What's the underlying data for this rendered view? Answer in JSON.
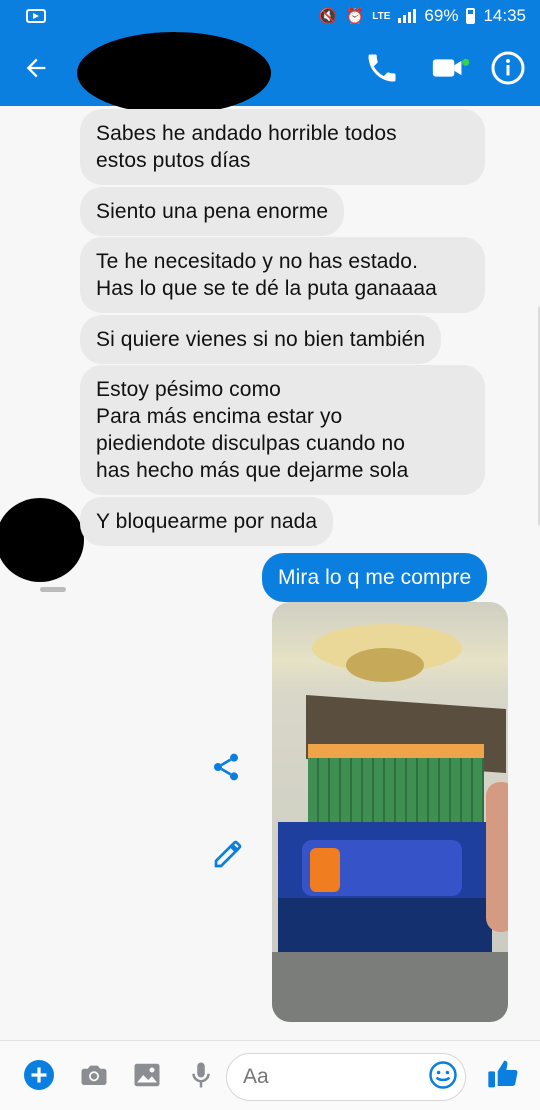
{
  "status_bar": {
    "network": "LTE",
    "battery": "69%",
    "time": "14:35"
  },
  "header": {
    "icons": [
      "back-arrow-icon",
      "phone-icon",
      "video-camera-icon",
      "info-icon"
    ],
    "accent_color": "#0a7fe0",
    "active_dot_color": "#3bd14c"
  },
  "messages": [
    {
      "direction": "incoming",
      "text": "Sabes he andado horrible todos\nestos putos días"
    },
    {
      "direction": "incoming",
      "text": "Siento una pena enorme"
    },
    {
      "direction": "incoming",
      "text": "Te he necesitado y no has estado.\nHas lo que se te dé la puta ganaaaa"
    },
    {
      "direction": "incoming",
      "text": "Si quiere vienes si no bien también"
    },
    {
      "direction": "incoming",
      "text": "Estoy pésimo como\nPara más encima estar yo\npiediendote disculpas cuando no\nhas hecho más que dejarme sola"
    },
    {
      "direction": "incoming",
      "text": "Y bloquearme por nada"
    },
    {
      "direction": "outgoing",
      "text": "Mira lo q me compre"
    }
  ],
  "photo": {
    "description_icons": [
      "share-icon",
      "edit-pencil-icon"
    ]
  },
  "composer": {
    "placeholder": "Aa",
    "icons": [
      "add-icon",
      "camera-icon",
      "gallery-icon",
      "microphone-icon",
      "emoji-icon",
      "like-thumb-icon"
    ]
  }
}
